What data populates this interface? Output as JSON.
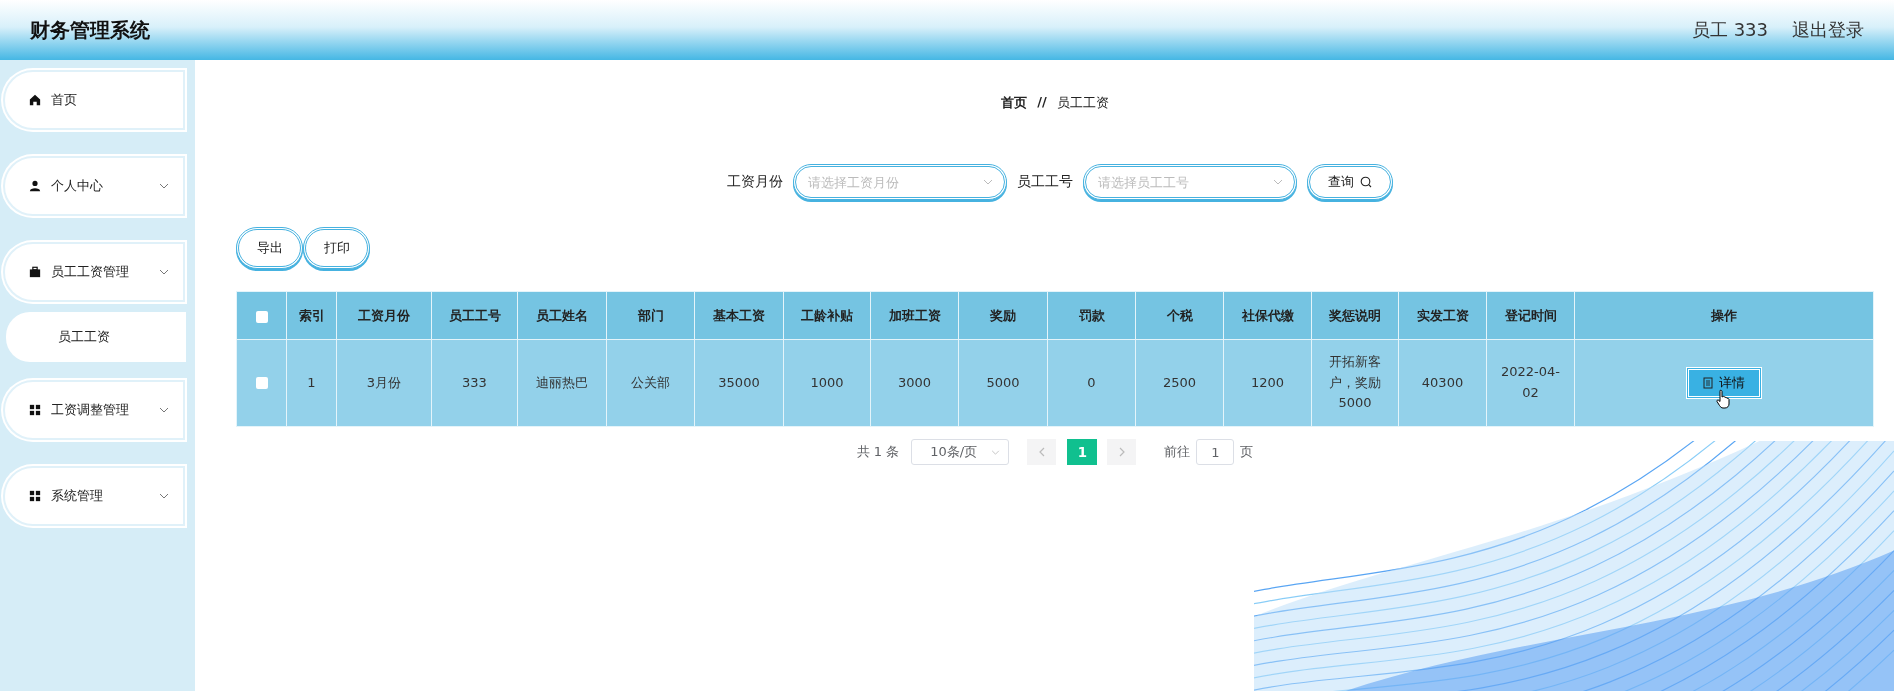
{
  "header": {
    "title": "财务管理系统",
    "user": "员工 333",
    "logout": "退出登录"
  },
  "sidebar": {
    "items": [
      {
        "label": "首页",
        "kind": "link"
      },
      {
        "label": "个人中心",
        "kind": "submenu"
      },
      {
        "label": "员工工资管理",
        "kind": "submenu",
        "children": [
          {
            "label": "员工工资"
          }
        ]
      },
      {
        "label": "工资调整管理",
        "kind": "submenu"
      },
      {
        "label": "系统管理",
        "kind": "submenu"
      }
    ]
  },
  "breadcrumb": {
    "home": "首页",
    "separator": "//",
    "current": "员工工资"
  },
  "search": {
    "fields": [
      {
        "label": "工资月份",
        "placeholder": "请选择工资月份"
      },
      {
        "label": "员工工号",
        "placeholder": "请选择员工工号"
      }
    ],
    "button": "查询"
  },
  "actions": [
    "导出",
    "打印"
  ],
  "table": {
    "select_all_checked": false,
    "columns": [
      "索引",
      "工资月份",
      "员工工号",
      "员工姓名",
      "部门",
      "基本工资",
      "工龄补贴",
      "加班工资",
      "奖励",
      "罚款",
      "个税",
      "社保代缴",
      "奖惩说明",
      "实发工资",
      "登记时间",
      "操作"
    ],
    "rows": [
      {
        "checked": false,
        "cells": [
          "1",
          "3月份",
          "333",
          "迪丽热巴",
          "公关部",
          "35000",
          "1000",
          "3000",
          "5000",
          "0",
          "2500",
          "1200",
          "开拓新客户，奖励5000",
          "40300",
          "2022-04-02"
        ],
        "action": "详情"
      }
    ]
  },
  "pagination": {
    "total": "共 1 条",
    "page_size": "10条/页",
    "pages": [
      {
        "label": "1",
        "selected": true
      }
    ],
    "goto_label": "前往",
    "goto_value": "1",
    "goto_suffix": "页"
  }
}
